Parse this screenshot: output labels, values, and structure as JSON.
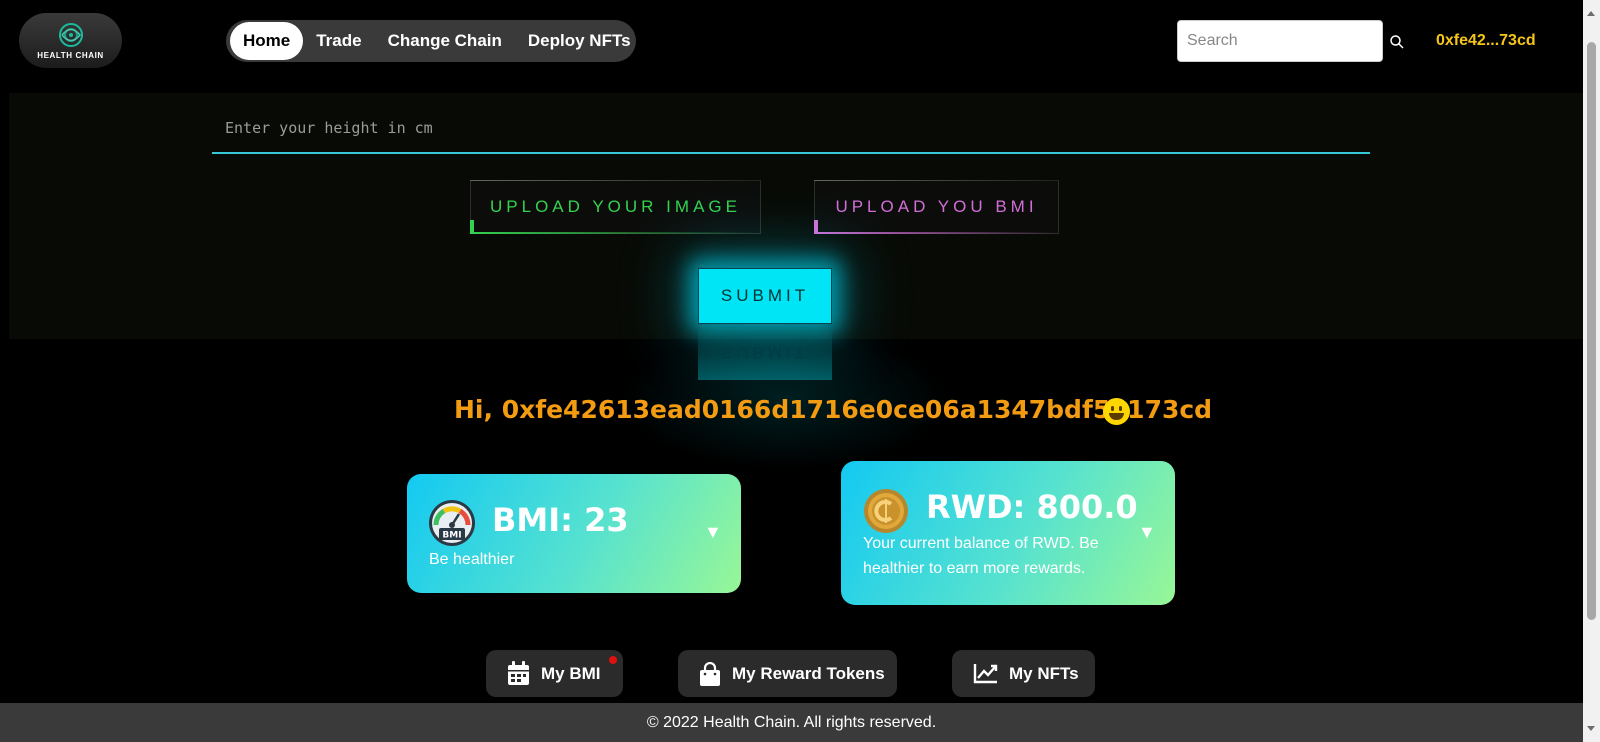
{
  "header": {
    "logo_text": "HEALTH CHAIN",
    "nav": [
      {
        "label": "Home",
        "active": true
      },
      {
        "label": "Trade"
      },
      {
        "label": "Change Chain"
      },
      {
        "label": "Deploy NFTs"
      }
    ],
    "search_placeholder": "Search",
    "wallet_short": "0xfe42...73cd"
  },
  "form": {
    "height_placeholder": "Enter your height in cm",
    "upload_image_label": "UPLOAD YOUR IMAGE",
    "upload_bmi_label": "UPLOAD YOU BMI",
    "submit_label": "SUBMIT"
  },
  "greeting": {
    "text": "Hi, 0xfe42613ead0166d1716e0ce06a1347bdf5e173cd",
    "emoji": "grinning-face"
  },
  "cards": {
    "bmi": {
      "title": "BMI: 23",
      "subtitle": "Be healthier",
      "gauge_label": "BMI",
      "arrow": "▼"
    },
    "rwd": {
      "title": "RWD: 800.0",
      "subtitle": "Your current balance of RWD. Be healthier to earn more rewards.",
      "arrow": "▼"
    }
  },
  "tabs": [
    {
      "label": "My BMI",
      "icon": "calendar-icon",
      "notification": true
    },
    {
      "label": "My Reward Tokens",
      "icon": "shopping-bag-icon"
    },
    {
      "label": "My NFTs",
      "icon": "chart-line-icon"
    }
  ],
  "footer": {
    "text": "© 2022 Health Chain. All rights reserved."
  },
  "colors": {
    "accent_cyan": "#00e5f5",
    "wallet_yellow": "#f5c518",
    "greeting_orange": "#f39c12",
    "upload_green": "#35d24f",
    "upload_pink": "#d36ed8"
  }
}
